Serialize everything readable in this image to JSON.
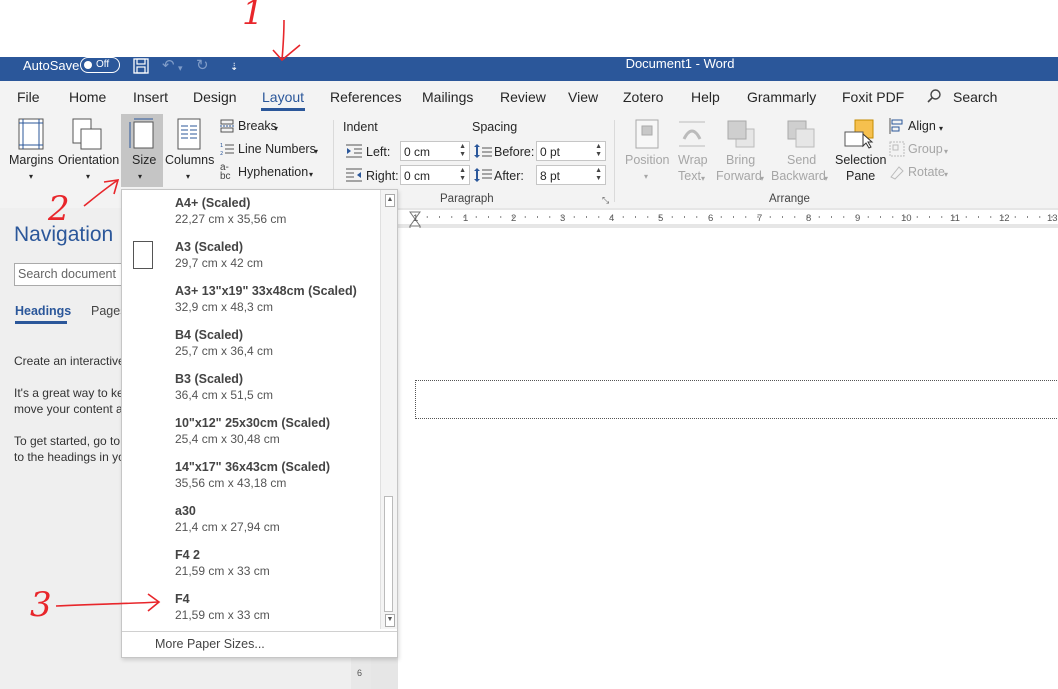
{
  "titlebar": {
    "autosave_label": "AutoSave",
    "autosave_state": "Off",
    "doc_title": "Document1  -  Word",
    "quick_access_more": "⇡"
  },
  "tabs": [
    {
      "label": "File"
    },
    {
      "label": "Home"
    },
    {
      "label": "Insert"
    },
    {
      "label": "Design"
    },
    {
      "label": "Layout",
      "active": true
    },
    {
      "label": "References"
    },
    {
      "label": "Mailings"
    },
    {
      "label": "Review"
    },
    {
      "label": "View"
    },
    {
      "label": "Zotero"
    },
    {
      "label": "Help"
    },
    {
      "label": "Grammarly"
    },
    {
      "label": "Foxit PDF"
    }
  ],
  "search_label": "Search",
  "ribbon": {
    "margins": "Margins",
    "orientation": "Orientation",
    "size": "Size",
    "columns": "Columns",
    "breaks": "Breaks",
    "line_numbers": "Line Numbers",
    "hyphenation": "Hyphenation",
    "indent": "Indent",
    "spacing": "Spacing",
    "left_label": "Left:",
    "left_value": "0 cm",
    "right_label": "Right:",
    "right_value": "0 cm",
    "before_label": "Before:",
    "before_value": "0 pt",
    "after_label": "After:",
    "after_value": "8 pt",
    "paragraph_group": "Paragraph",
    "position": "Position",
    "wrap": "Wrap",
    "wrap2": "Text",
    "bring": "Bring",
    "bring2": "Forward",
    "send": "Send",
    "send2": "Backward",
    "selection": "Selection",
    "selection2": "Pane",
    "align": "Align",
    "group": "Group",
    "rotate": "Rotate",
    "arrange_group": "Arrange"
  },
  "ruler": [
    "1",
    "2",
    "3",
    "4",
    "5",
    "6",
    "7",
    "8",
    "9",
    "10",
    "11",
    "12",
    "13"
  ],
  "navigation": {
    "title": "Navigation",
    "search_placeholder": "Search document",
    "tab_headings": "Headings",
    "tab_pages": "Pages",
    "text1": "Create an interactive",
    "text2a": "It's a great way to ke",
    "text2b": "move your content a",
    "text3a": "To get started, go to",
    "text3b": "to the headings in yo"
  },
  "size_dropdown": {
    "items": [
      {
        "name": "A4+ (Scaled)",
        "dims": "22,27 cm x 35,56 cm"
      },
      {
        "name": "A3 (Scaled)",
        "dims": "29,7 cm x 42 cm"
      },
      {
        "name": "A3+ 13\"x19\" 33x48cm (Scaled)",
        "dims": "32,9 cm x 48,3 cm"
      },
      {
        "name": "B4 (Scaled)",
        "dims": "25,7 cm x 36,4 cm"
      },
      {
        "name": "B3 (Scaled)",
        "dims": "36,4 cm x 51,5 cm"
      },
      {
        "name": "10\"x12\" 25x30cm (Scaled)",
        "dims": "25,4 cm x 30,48 cm"
      },
      {
        "name": "14\"x17\" 36x43cm (Scaled)",
        "dims": "35,56 cm x 43,18 cm"
      },
      {
        "name": "a30",
        "dims": "21,4 cm x 27,94 cm"
      },
      {
        "name": "F4 2",
        "dims": "21,59 cm x 33 cm"
      },
      {
        "name": "F4",
        "dims": "21,59 cm x 33 cm"
      }
    ],
    "more": "More Paper Sizes..."
  },
  "vruler_num": "6",
  "annotations": {
    "n1": "1",
    "n2": "2",
    "n3": "3"
  },
  "colors": {
    "accent": "#2b579a",
    "annotation": "#e8262b"
  }
}
